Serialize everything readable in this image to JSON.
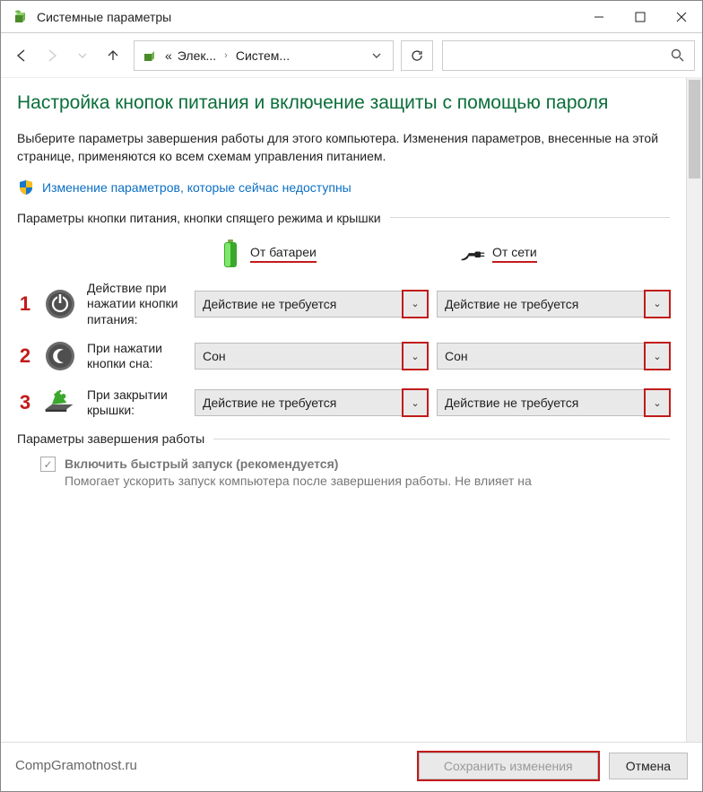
{
  "window": {
    "title": "Системные параметры"
  },
  "breadcrumb": {
    "prefix": "«",
    "level1": "Элек...",
    "sep": "›",
    "level2": "Систем..."
  },
  "page": {
    "heading": "Настройка кнопок питания и включение защиты с помощью пароля",
    "intro": "Выберите параметры завершения работы для этого компьютера. Изменения параметров, внесенные на этой странице, применяются ко всем схемам управления питанием.",
    "uac_link": "Изменение параметров, которые сейчас недоступны"
  },
  "group_buttons": {
    "label": "Параметры кнопки питания, кнопки спящего режима и крышки",
    "battery_header": "От батареи",
    "plugged_header": "От сети",
    "rows": [
      {
        "num": "1",
        "label": "Действие при нажатии кнопки питания:",
        "battery_value": "Действие не требуется",
        "plugged_value": "Действие не требуется"
      },
      {
        "num": "2",
        "label": "При нажатии кнопки сна:",
        "battery_value": "Сон",
        "plugged_value": "Сон"
      },
      {
        "num": "3",
        "label": "При закрытии крышки:",
        "battery_value": "Действие не требуется",
        "plugged_value": "Действие не требуется"
      }
    ]
  },
  "group_shutdown": {
    "label": "Параметры завершения работы",
    "fast_title": "Включить быстрый запуск (рекомендуется)",
    "fast_desc": "Помогает ускорить запуск компьютера после завершения работы. Не влияет на"
  },
  "footer": {
    "watermark": "CompGramotnost.ru",
    "save": "Сохранить изменения",
    "cancel": "Отмена"
  }
}
